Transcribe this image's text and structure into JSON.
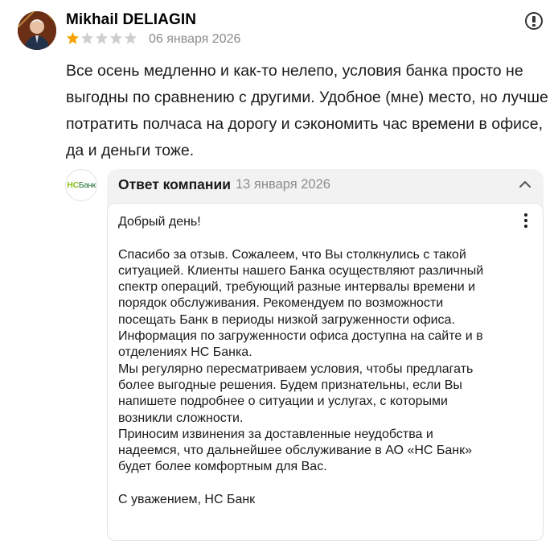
{
  "review": {
    "author": "Mikhail DELIAGIN",
    "rating": 1,
    "max_rating": 5,
    "date": "06 января 2026",
    "text": "Все осень медленно и как-то нелепо, условия банка просто не выгодны по сравнению с другими. Удобное (мне) место, но лучше потратить полчаса на дорогу и сэкономить час времени в офисе, да и деньги тоже."
  },
  "company_logo": {
    "ns": "НС",
    "bank": "Банк"
  },
  "reply": {
    "header": "Ответ компании",
    "date": "13 января 2026",
    "greeting": "Добрый день!",
    "paragraphs": [
      "Спасибо за отзыв. Сожалеем, что Вы столкнулись с такой ситуацией. Клиенты нашего Банка осуществляют различный спектр операций, требующий разные интервалы времени и порядок обслуживания. Рекомендуем по возможности посещать Банк в периоды низкой загруженности офиса. Информация по загруженности офиса доступна на сайте и в отделениях НС Банка.",
      "Мы регулярно пересматриваем условия, чтобы предлагать более выгодные решения. Будем признательны, если Вы напишете подробнее о ситуации и услугах, с которыми возникли сложности.",
      "Приносим извинения за доставленные неудобства и надеемся, что дальнейшее обслуживание в АО «НС Банк» будет более комфортным для Вас."
    ],
    "signature": "С уважением, НС Банк"
  },
  "colors": {
    "star_filled": "#f6a100",
    "star_empty": "#cfcfcf",
    "logo_green_light": "#8bbf1f",
    "logo_green_dark": "#1f6f33"
  },
  "icons": [
    "report-icon",
    "chevron-up-icon",
    "more-vertical-icon"
  ]
}
